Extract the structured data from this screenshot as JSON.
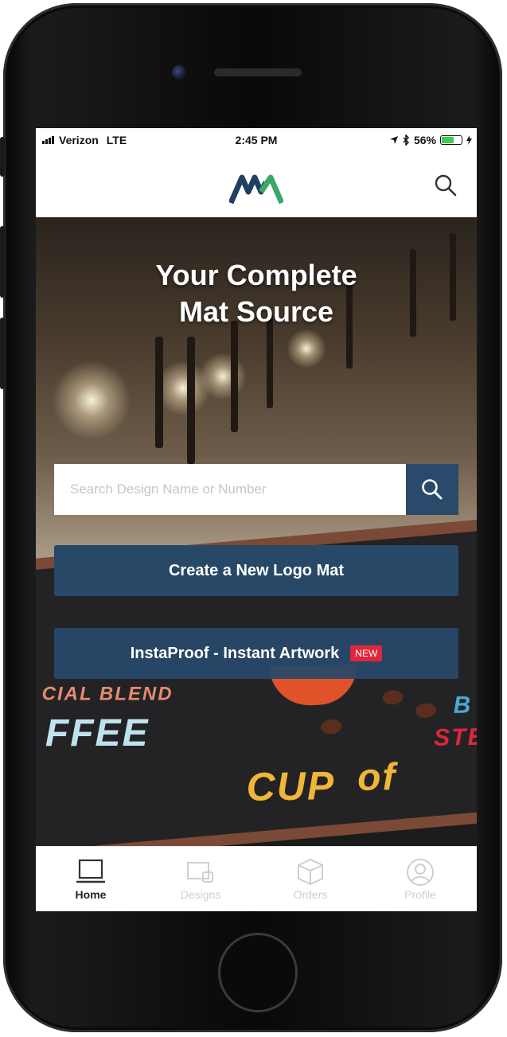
{
  "status_bar": {
    "carrier": "Verizon",
    "network": "LTE",
    "time": "2:45 PM",
    "battery": "56%",
    "battery_level": 0.56,
    "icons": [
      "signal-icon",
      "location-arrow-icon",
      "bluetooth-icon",
      "battery-icon",
      "charging-icon"
    ]
  },
  "header": {
    "logo": "MA",
    "logo_colors": [
      "#1f3f63",
      "#3aa86b"
    ],
    "search_icon": "search-icon"
  },
  "hero": {
    "title_line1": "Your Complete",
    "title_line2": "Mat Source"
  },
  "search": {
    "placeholder": "Search Design Name or Number",
    "button_icon": "search-icon"
  },
  "buttons": {
    "create_label": "Create a New Logo Mat",
    "insta_label": "InstaProof - Instant Artwork",
    "new_badge": "NEW"
  },
  "tabs": [
    {
      "label": "Home",
      "icon": "laptop-icon",
      "active": true
    },
    {
      "label": "Designs",
      "icon": "designs-icon",
      "active": false
    },
    {
      "label": "Orders",
      "icon": "box-icon",
      "active": false
    },
    {
      "label": "Profile",
      "icon": "user-icon",
      "active": false
    }
  ],
  "colors": {
    "primary": "#284868",
    "badge": "#e0263b",
    "battery": "#3ccf4e"
  }
}
